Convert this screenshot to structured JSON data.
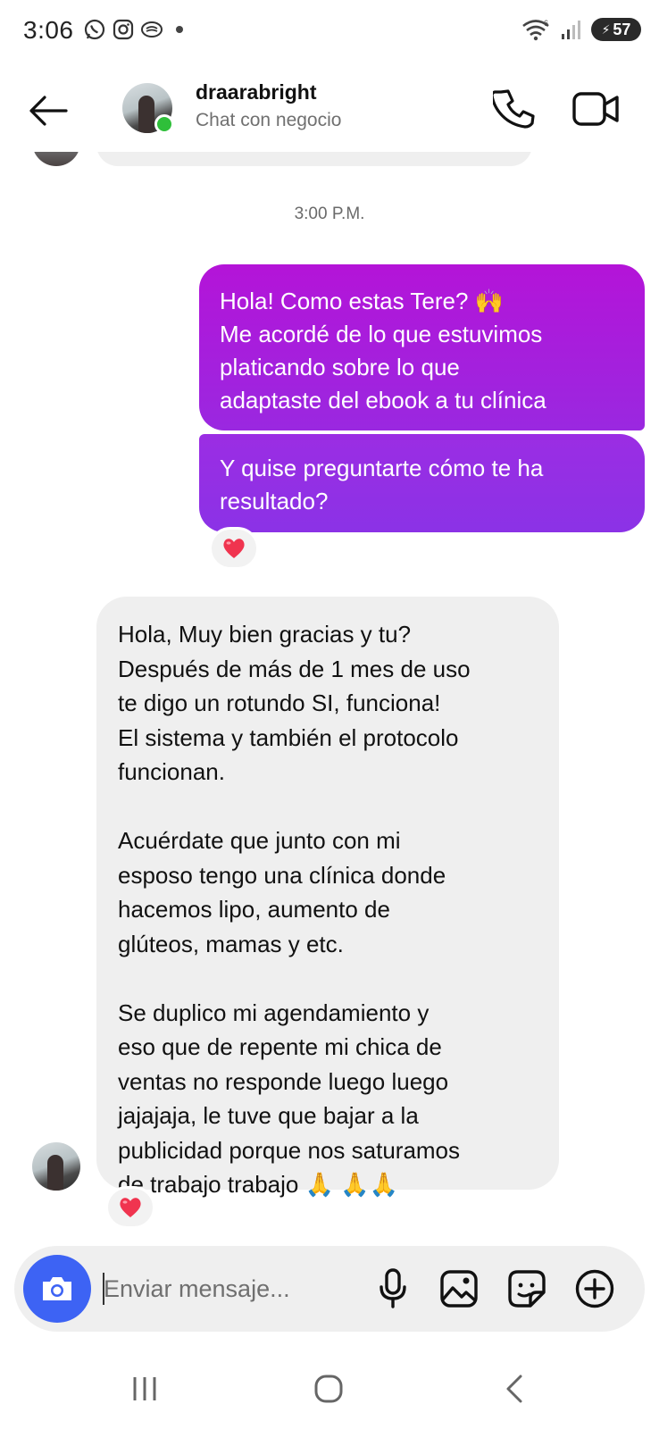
{
  "status_bar": {
    "time": "3:06",
    "battery": "57",
    "notification_icons": [
      "whatsapp-icon",
      "instagram-icon",
      "chat-bubble-icon"
    ],
    "system_icons": [
      "wifi-icon",
      "signal-icon",
      "battery-icon"
    ]
  },
  "header": {
    "contact_name": "draarabright",
    "contact_subtitle": "Chat con negocio",
    "online": true,
    "icons": [
      "back-arrow-icon",
      "phone-icon",
      "video-camera-icon"
    ]
  },
  "chat": {
    "timestamp": "3:00 P.M.",
    "outgoing": [
      {
        "lines": [
          "Hola! Como estas Tere? 🙌",
          "Me acordé de lo que estuvimos",
          "platicando sobre lo que",
          "adaptaste del ebook a tu clínica"
        ]
      },
      {
        "lines": [
          "Y quise preguntarte cómo te ha",
          "resultado?"
        ],
        "reaction": "❤️"
      }
    ],
    "incoming": {
      "lines": [
        "Hola, Muy bien gracias y tu?",
        "Después de más de 1 mes de uso",
        "te digo un rotundo SI, funciona!",
        "El sistema y también el protocolo",
        "funcionan.",
        "",
        "Acuérdate que junto con mi",
        "esposo tengo una clínica donde",
        "hacemos lipo, aumento de",
        "glúteos, mamas y etc.",
        "",
        "Se duplico mi agendamiento y",
        "eso que de repente mi chica de",
        "ventas no responde luego luego",
        "jajajaja, le tuve que bajar a la",
        "publicidad porque nos saturamos",
        "de trabajo trabajo 🙏 🙏🙏"
      ],
      "reaction": "❤️"
    }
  },
  "composer": {
    "placeholder": "Enviar mensaje...",
    "icons": [
      "camera-icon",
      "microphone-icon",
      "gallery-icon",
      "sticker-icon",
      "plus-circle-icon"
    ],
    "camera_color": "#3d63f4"
  },
  "nav_bar": {
    "icons": [
      "recent-apps-icon",
      "home-icon",
      "back-icon"
    ]
  },
  "colors": {
    "outgoing_bubble_top": "#b414d8",
    "outgoing_bubble_bottom": "#8b32e6",
    "incoming_bubble": "#efefef",
    "online_dot": "#2fbf3a"
  }
}
